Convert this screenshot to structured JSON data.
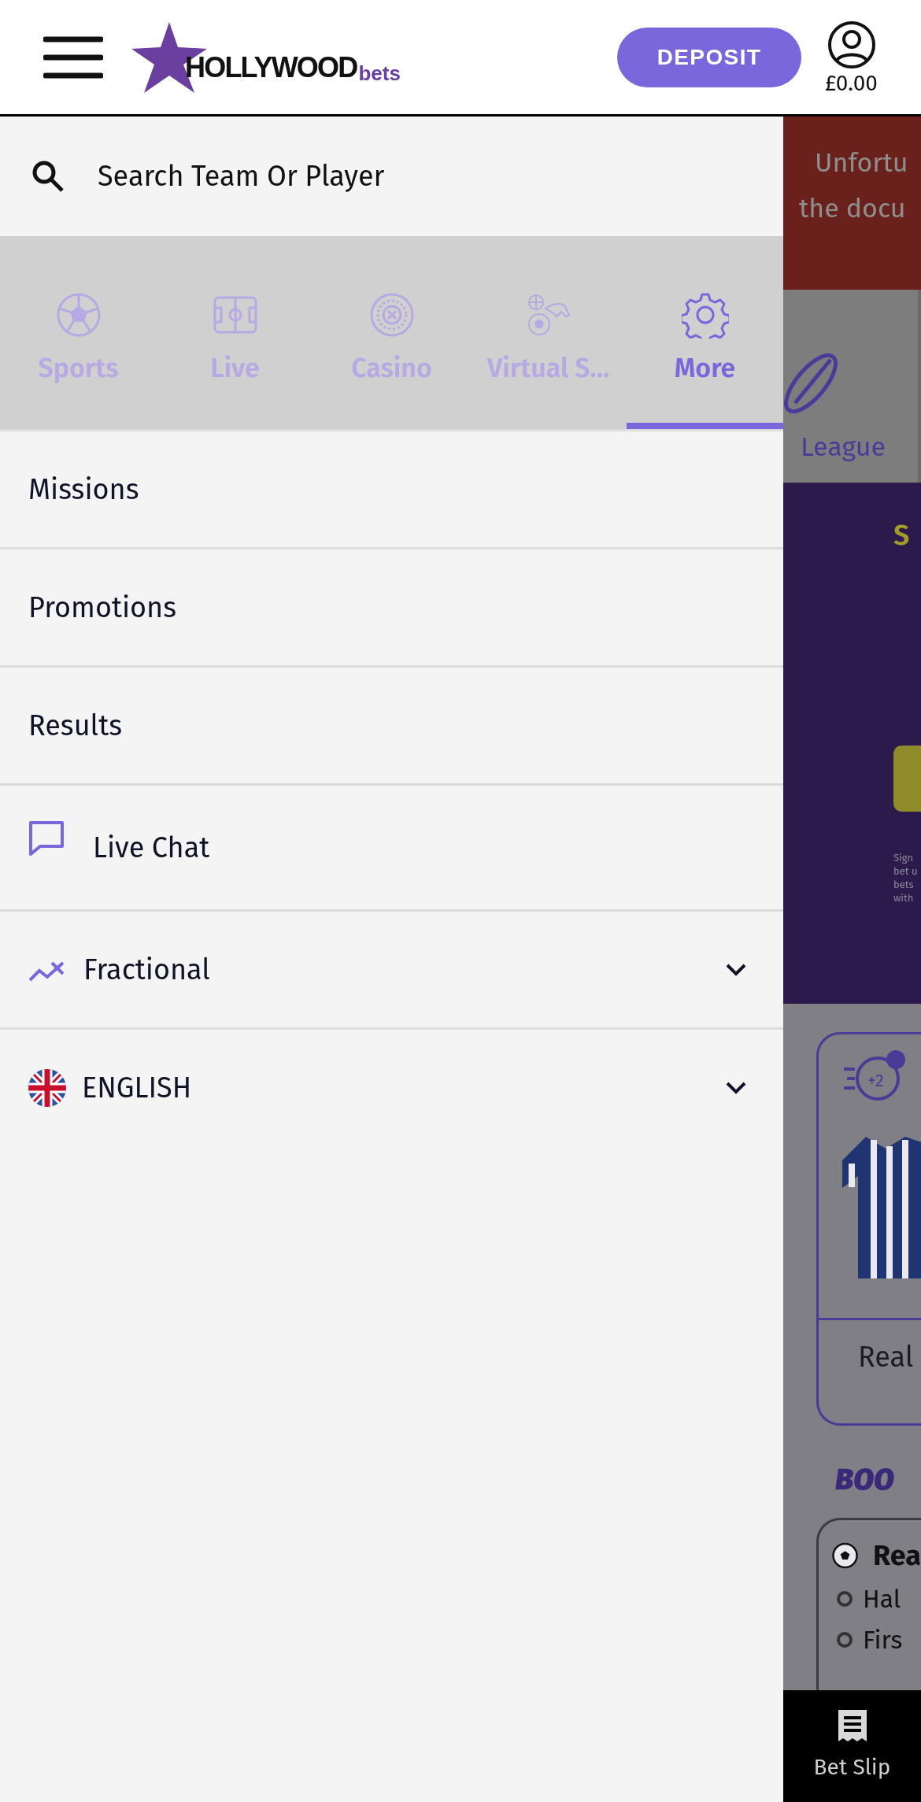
{
  "header": {
    "logo": "HOLLYWOOD",
    "logo_suffix": "bets",
    "deposit": "DEPOSIT",
    "balance": "£0.00"
  },
  "search": {
    "placeholder": "Search Team Or Player"
  },
  "tabs": [
    {
      "label": "Sports",
      "kind": "ball",
      "selected": false
    },
    {
      "label": "Live",
      "kind": "pitch",
      "selected": false
    },
    {
      "label": "Casino",
      "kind": "roulette",
      "selected": false
    },
    {
      "label": "Virtual S...",
      "kind": "virtual",
      "selected": false
    },
    {
      "label": "More",
      "kind": "gear",
      "selected": true
    }
  ],
  "menu": [
    {
      "label": "Missions",
      "kind": "plain"
    },
    {
      "label": "Promotions",
      "kind": "plain"
    },
    {
      "label": "Results",
      "kind": "plain"
    },
    {
      "label": "Live Chat",
      "kind": "chat"
    },
    {
      "label": "Fractional",
      "kind": "odds",
      "expanded": false
    },
    {
      "label": "ENGLISH",
      "kind": "flag",
      "expanded": false
    }
  ],
  "background": {
    "banner": [
      "Unfortu",
      "the docu"
    ],
    "league": "League",
    "promo": {
      "kicker": "S",
      "fine": [
        "Sign",
        "bet u",
        "bets",
        "with"
      ]
    },
    "card": {
      "badge": "+2",
      "team": "Real"
    },
    "boost": "BOO",
    "match": {
      "team": "Rea",
      "lines": [
        "Hal",
        "Firs"
      ]
    },
    "bet_slip": "Bet Slip"
  }
}
